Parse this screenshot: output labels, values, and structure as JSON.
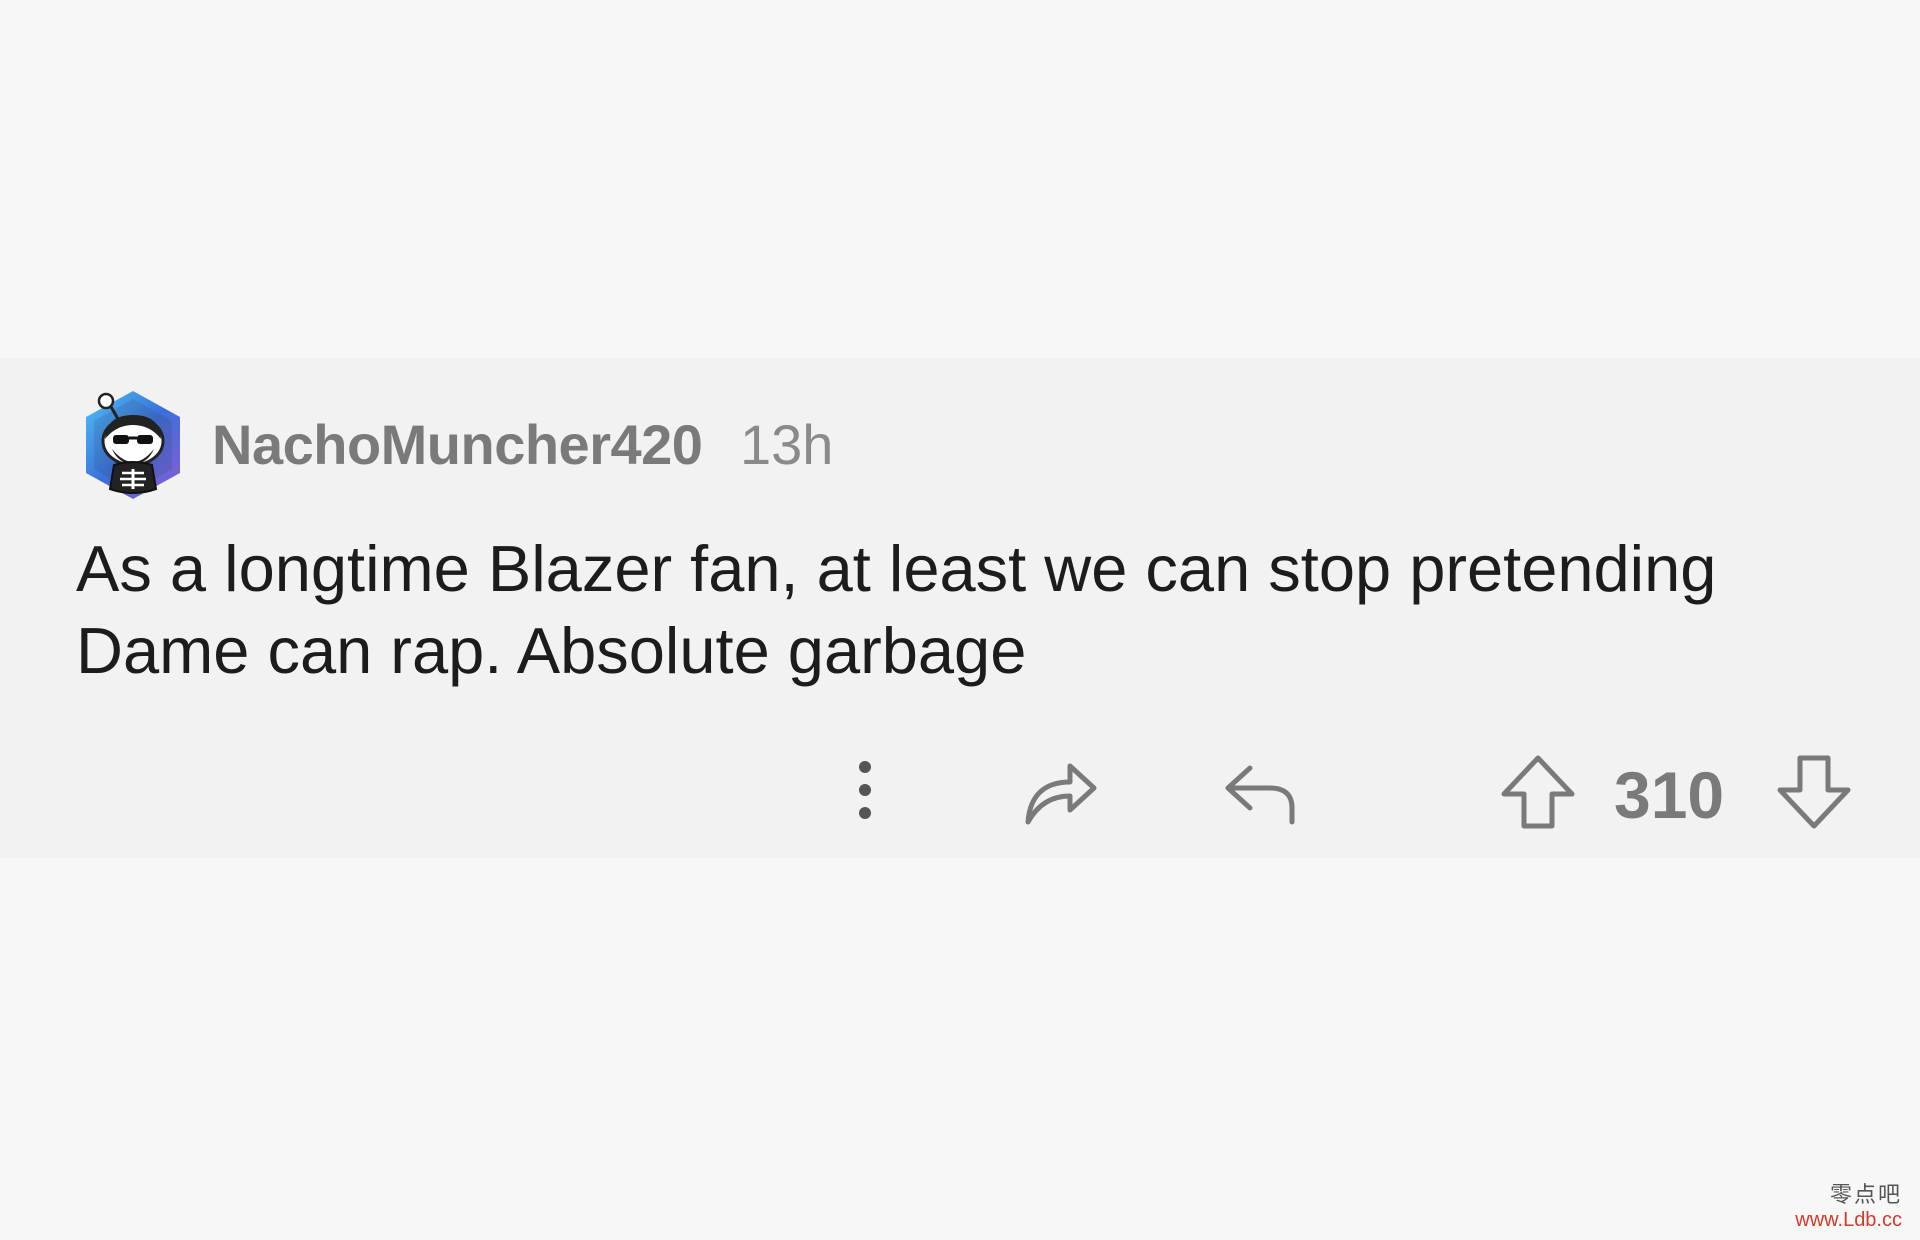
{
  "comment": {
    "author": "NachoMuncher420",
    "time_ago": "13h",
    "body_lines": [
      "As a longtime Blazer fan, at least we can stop pretending",
      "Dame can rap. Absolute garbage"
    ],
    "vote_count": "310",
    "actions": {
      "more_icon": "vertical-dots-icon",
      "share_icon": "share-arrow-icon",
      "reply_icon": "reply-arrow-icon",
      "upvote_icon": "arrow-up-icon",
      "downvote_icon": "arrow-down-icon"
    },
    "avatar_icon": "snoo-avatar-icon"
  },
  "watermark": {
    "chinese": "零点吧",
    "url": "www.Ldb.cc"
  },
  "colors": {
    "page_background": "#f7f7f7",
    "card_background": "#f2f2f2",
    "meta_text": "#7a7a7a",
    "body_text": "#1c1c1c",
    "icon_stroke": "#7a7a7a",
    "watermark": "#d23b2a"
  }
}
